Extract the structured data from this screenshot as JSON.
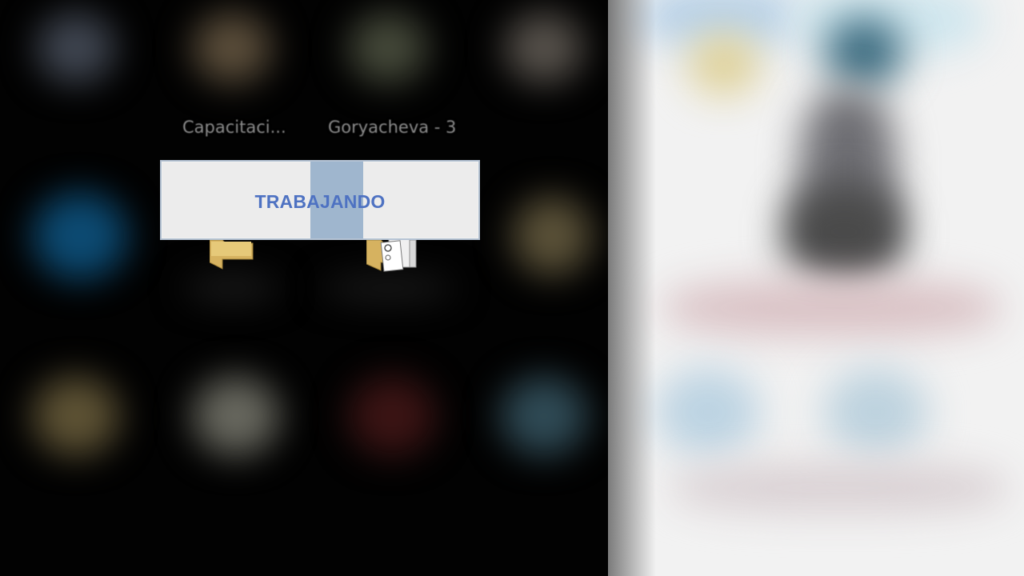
{
  "desktop": {
    "icons": [
      {
        "label": "Capacitaci..."
      },
      {
        "label": "Goryacheva - 3"
      }
    ]
  },
  "progress_dialog": {
    "status": "TRABAJANDO"
  },
  "colors": {
    "status_text": "#4e72c2",
    "indicator": "#9fb6ce",
    "dialog_background": "#ececec",
    "dialog_border": "#b5c3d4"
  },
  "icons": {
    "folder_1": "folder-icon",
    "folder_2": "folder-with-documents-icon"
  }
}
